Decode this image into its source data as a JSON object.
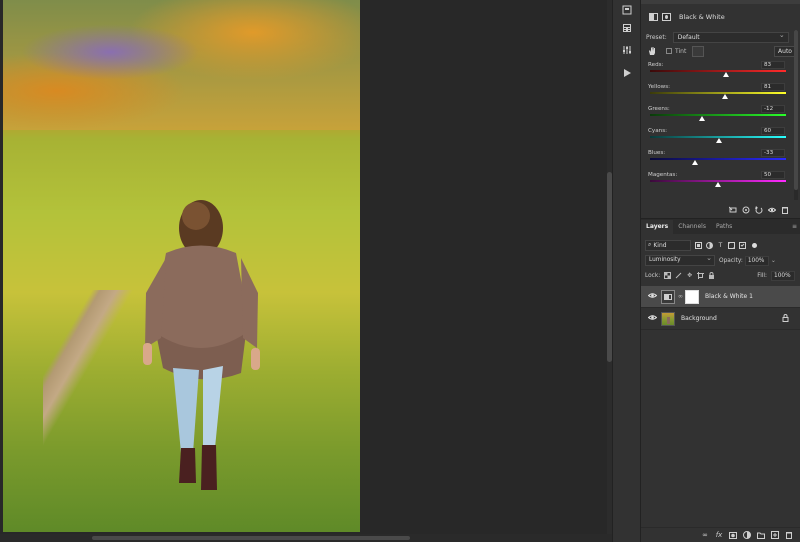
{
  "properties": {
    "adjustment_title": "Black & White",
    "preset_label": "Preset:",
    "preset_value": "Default",
    "tint_label": "Tint",
    "auto_label": "Auto",
    "sliders": [
      {
        "label": "Reds:",
        "value": "83",
        "pos": 0.56,
        "gradient": "linear-gradient(90deg,#3a0a0a,#ff2a2a)"
      },
      {
        "label": "Yellows:",
        "value": "81",
        "pos": 0.55,
        "gradient": "linear-gradient(90deg,#3a3a0a,#ffff2a)"
      },
      {
        "label": "Greens:",
        "value": "-12",
        "pos": 0.38,
        "gradient": "linear-gradient(90deg,#0a3a0a,#2aff2a)"
      },
      {
        "label": "Cyans:",
        "value": "60",
        "pos": 0.51,
        "gradient": "linear-gradient(90deg,#0a3a3a,#2affff)"
      },
      {
        "label": "Blues:",
        "value": "-33",
        "pos": 0.33,
        "gradient": "linear-gradient(90deg,#0a0a3a,#2a2aff)"
      },
      {
        "label": "Magentas:",
        "value": "50",
        "pos": 0.5,
        "gradient": "linear-gradient(90deg,#3a0a3a,#ff2aff)"
      }
    ]
  },
  "layers_panel": {
    "tabs": [
      "Layers",
      "Channels",
      "Paths"
    ],
    "kind_label": "Kind",
    "blend_mode": "Luminosity",
    "opacity_label": "Opacity:",
    "opacity_value": "100%",
    "lock_label": "Lock:",
    "fill_label": "Fill:",
    "fill_value": "100%",
    "layers": [
      {
        "name": "Black & White 1",
        "selected": true
      },
      {
        "name": "Background",
        "selected": false
      }
    ]
  },
  "icons": {
    "eye": "eye-icon",
    "lock": "lock-icon",
    "hand": "targeted-adjustment-icon"
  },
  "colors": {
    "panel_bg": "#323232",
    "canvas_bg": "#282828",
    "selected_row": "#4a4a4a"
  }
}
